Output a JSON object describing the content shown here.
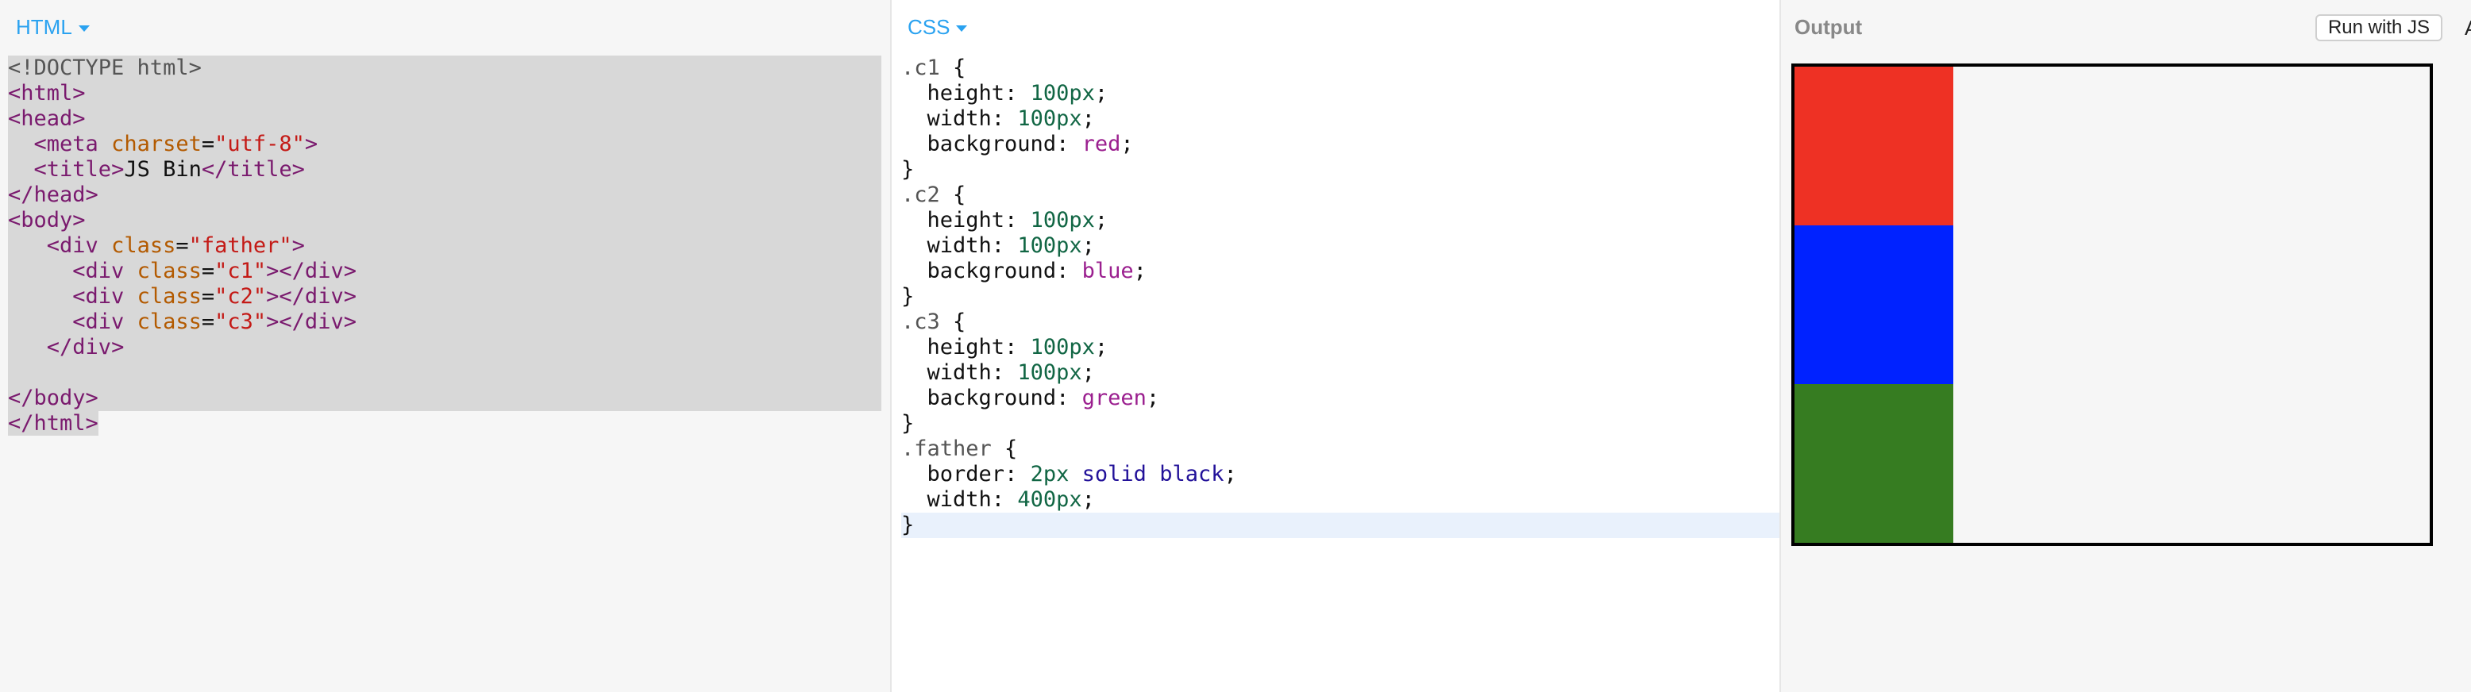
{
  "panels": {
    "html": {
      "label": "HTML"
    },
    "css": {
      "label": "CSS"
    },
    "output": {
      "label": "Output",
      "run_button": "Run with JS",
      "edge_label": "A"
    }
  },
  "html_code_lines": [
    "<!DOCTYPE html>",
    "<html>",
    "<head>",
    "  <meta charset=\"utf-8\">",
    "  <title>JS Bin</title>",
    "</head>",
    "<body>",
    "   <div class=\"father\">",
    "     <div class=\"c1\"></div>",
    "     <div class=\"c2\"></div>",
    "     <div class=\"c3\"></div>",
    "   </div>",
    "",
    "</body>",
    "</html>"
  ],
  "css_code_lines": [
    ".c1 {",
    "  height: 100px;",
    "  width: 100px;",
    "  background: red;",
    "}",
    ".c2 {",
    "  height: 100px;",
    "  width: 100px;",
    "  background: blue;",
    "}",
    ".c3 {",
    "  height: 100px;",
    "  width: 100px;",
    "  background: green;",
    "}",
    ".father {",
    "  border: 2px solid black;",
    "  width: 400px;",
    "}"
  ],
  "preview_boxes": [
    {
      "name": "c1",
      "color": "#ee3124"
    },
    {
      "name": "c2",
      "color": "#0022ff"
    },
    {
      "name": "c3",
      "color": "#367c21"
    }
  ],
  "colors": {
    "accent": "#2aa2f0",
    "html_selection": "#d8d8d8",
    "css_active_line": "#e9f1fc"
  }
}
